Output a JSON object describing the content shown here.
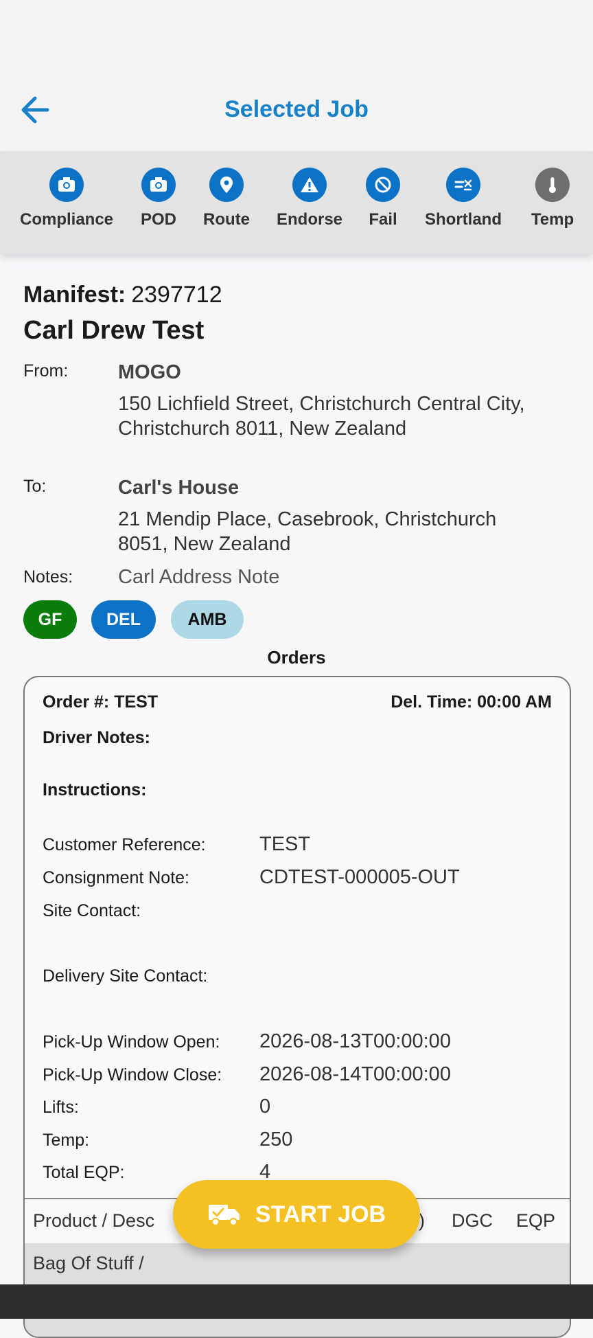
{
  "header": {
    "title": "Selected Job"
  },
  "toolbar": [
    {
      "label": "Compliance",
      "icon": "camera-icon"
    },
    {
      "label": "POD",
      "icon": "camera-icon"
    },
    {
      "label": "Route",
      "icon": "location-pin-icon"
    },
    {
      "label": "Endorse",
      "icon": "warning-icon"
    },
    {
      "label": "Fail",
      "icon": "prohibited-icon"
    },
    {
      "label": "Shortland",
      "icon": "shortland-icon"
    },
    {
      "label": "Temp",
      "icon": "thermometer-icon"
    }
  ],
  "job": {
    "manifest_label": "Manifest:",
    "manifest_number": "2397712",
    "name": "Carl Drew Test",
    "from_label": "From:",
    "from_name": "MOGO",
    "from_address": "150 Lichfield Street, Christchurch Central City, Christchurch 8011, New Zealand",
    "to_label": "To:",
    "to_name": "Carl's House",
    "to_address": "21 Mendip Place, Casebrook, Christchurch 8051, New Zealand",
    "notes_label": "Notes:",
    "notes": "Carl Address Note",
    "tags": [
      {
        "label": "GF",
        "bg": "#0a7d0a",
        "fg": "#ffffff"
      },
      {
        "label": "DEL",
        "bg": "#0b72c6",
        "fg": "#ffffff"
      },
      {
        "label": "AMB",
        "bg": "#add8e6",
        "fg": "#111111"
      }
    ],
    "orders_title": "Orders"
  },
  "order": {
    "order_no": "Order #: TEST",
    "del_time": "Del. Time: 00:00 AM",
    "driver_notes_label": "Driver Notes:",
    "instructions_label": "Instructions:",
    "customer_ref_label": "Customer Reference:",
    "customer_ref": "TEST",
    "consignment_label": "Consignment Note:",
    "consignment": "CDTEST-000005-OUT",
    "site_contact_label": "Site Contact:",
    "delivery_site_contact_label": "Delivery Site Contact:",
    "pickup_open_label": "Pick-Up Window Open:",
    "pickup_open": "2026-08-13T00:00:00",
    "pickup_close_label": "Pick-Up Window Close:",
    "pickup_close": "2026-08-14T00:00:00",
    "lifts_label": "Lifts:",
    "lifts": "0",
    "temp_label": "Temp:",
    "temp": "250",
    "total_eqp_label": "Total EQP:",
    "total_eqp": "4"
  },
  "table": {
    "headers": {
      "product": "Product / Desc",
      "hidden": ")",
      "dgc": "DGC",
      "eqp": "EQP"
    },
    "row": {
      "product_line1": "Bag Of Stuff /"
    }
  },
  "actions": {
    "start_job": "START JOB"
  },
  "colors": {
    "accent": "#0b72c6",
    "start": "#f5c024",
    "title": "#1782c8"
  }
}
